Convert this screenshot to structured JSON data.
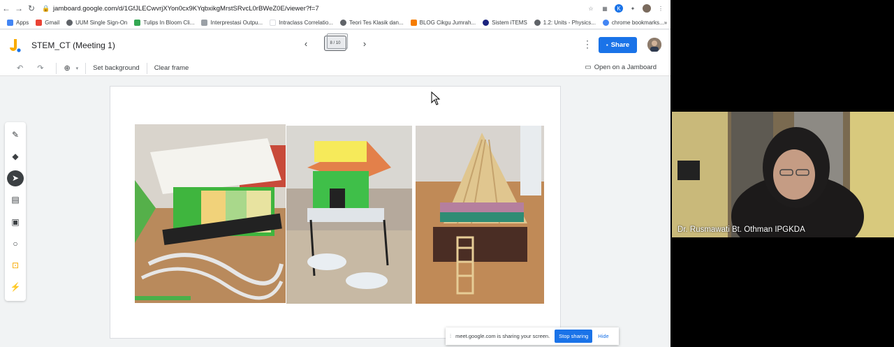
{
  "browser": {
    "url": "jamboard.google.com/d/1GfJLECwvrjXYon0cx9KYqbxikgMrstSRvcL0rBWeZ0E/viewer?f=7"
  },
  "bookmarks": [
    {
      "label": "Apps",
      "color": "#4285f4"
    },
    {
      "label": "Gmail",
      "color": "#ea4335"
    },
    {
      "label": "UUM Single Sign-On",
      "color": "#5f6368"
    },
    {
      "label": "Tulips In Bloom Cli...",
      "color": "#34a853"
    },
    {
      "label": "Interprestasi Outpu...",
      "color": "#9aa0a6"
    },
    {
      "label": "Intraclass Correlatio...",
      "color": "#ffffff"
    },
    {
      "label": "Teori Tes Klasik dan...",
      "color": "#5f6368"
    },
    {
      "label": "BLOG Cikgu Jumrah...",
      "color": "#f57c00"
    },
    {
      "label": "Sistem iTEMS",
      "color": "#1a237e"
    },
    {
      "label": "1.2: Units - Physics...",
      "color": "#5f6368"
    },
    {
      "label": "chrome bookmarks...",
      "color": "#4285f4"
    }
  ],
  "bookmarks_more": "»",
  "jamboard": {
    "title": "STEM_CT (Meeting 1)",
    "frame_indicator": "8 / 10",
    "share_label": "Share",
    "toolbar": {
      "set_background": "Set background",
      "clear_frame": "Clear frame",
      "open_on_jamboard": "Open on a Jamboard"
    }
  },
  "screen_share": {
    "message": "meet.google.com is sharing your screen.",
    "stop_label": "Stop sharing",
    "hide_label": "Hide"
  },
  "video": {
    "speaker_name": "Dr. Rusmawati Bt. Othman IPGKDA"
  },
  "colors": {
    "accent": "#1a73e8",
    "jamboard_yellow": "#f9ab00"
  }
}
